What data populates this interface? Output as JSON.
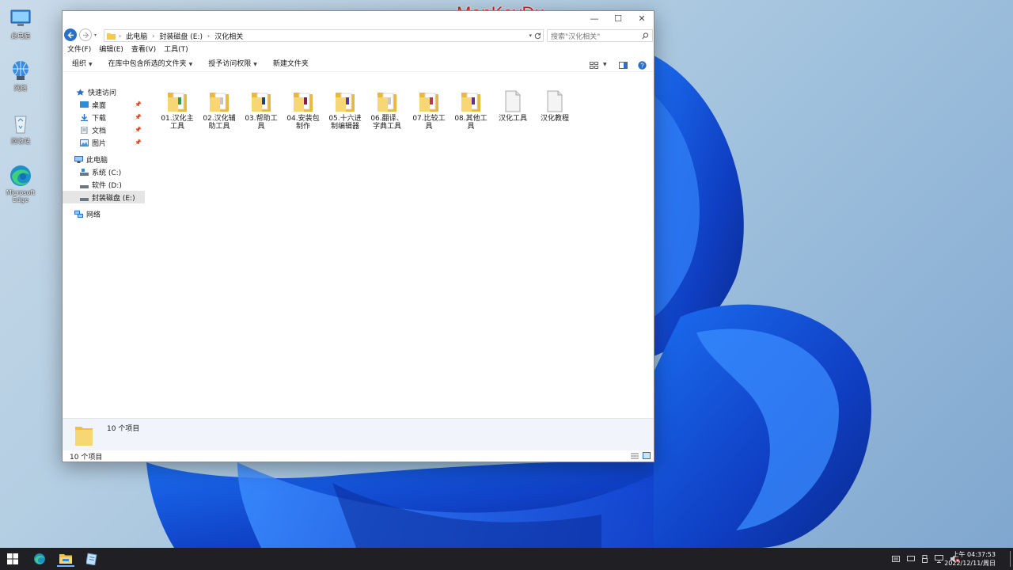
{
  "watermark": "MonKeyDu",
  "desktop": {
    "icons": [
      {
        "label": "此电脑",
        "icon": "computer-icon"
      },
      {
        "label": "网络",
        "icon": "network-icon"
      },
      {
        "label": "回收站",
        "icon": "recycle-bin-icon"
      },
      {
        "label": "Microsoft Edge",
        "icon": "edge-icon"
      }
    ]
  },
  "window": {
    "controls": {
      "minimize": "—",
      "maximize": "☐",
      "close": "✕"
    },
    "address": {
      "crumbs": [
        "此电脑",
        "封装磁盘 (E:)",
        "汉化相关"
      ]
    },
    "search": {
      "placeholder": "搜索\"汉化相关\""
    },
    "menu": [
      "文件(F)",
      "编辑(E)",
      "查看(V)",
      "工具(T)"
    ],
    "commands": [
      {
        "label": "组织",
        "dropdown": true
      },
      {
        "label": "在库中包含所选的文件夹",
        "dropdown": true
      },
      {
        "label": "授予访问权限",
        "dropdown": true
      },
      {
        "label": "新建文件夹",
        "dropdown": false
      }
    ],
    "nav": {
      "quick_access": "快速访问",
      "quick_items": [
        {
          "label": "桌面",
          "pinned": true
        },
        {
          "label": "下载",
          "pinned": true
        },
        {
          "label": "文档",
          "pinned": true
        },
        {
          "label": "图片",
          "pinned": true
        }
      ],
      "this_pc": "此电脑",
      "drives": [
        {
          "label": "系统 (C:)"
        },
        {
          "label": "软件 (D:)"
        },
        {
          "label": "封装磁盘 (E:)",
          "selected": true
        }
      ],
      "network": "网络"
    },
    "files": [
      {
        "line1": "01.汉化主",
        "line2": "工具",
        "type": "folder",
        "accent": "#2a9d4a"
      },
      {
        "line1": "02.汉化辅",
        "line2": "助工具",
        "type": "folder",
        "accent": "#c8c8c8"
      },
      {
        "line1": "03.帮助工",
        "line2": "具",
        "type": "folder",
        "accent": "#1f3f8a"
      },
      {
        "line1": "04.安装包",
        "line2": "制作",
        "type": "folder",
        "accent": "#8b1a4a"
      },
      {
        "line1": "05.十六进",
        "line2": "制编辑器",
        "type": "folder",
        "accent": "#5b3aa0"
      },
      {
        "line1": "06.翻译、",
        "line2": "字典工具",
        "type": "folder",
        "accent": "#c8c8c8"
      },
      {
        "line1": "07.比较工",
        "line2": "具",
        "type": "folder",
        "accent": "#b03a5a"
      },
      {
        "line1": "08.其他工",
        "line2": "具",
        "type": "folder",
        "accent": "#6a2a9a"
      },
      {
        "line1": "汉化工具",
        "line2": "",
        "type": "file",
        "accent": "#d0d0d0"
      },
      {
        "line1": "汉化教程",
        "line2": "",
        "type": "file",
        "accent": "#d0d0d0"
      }
    ],
    "details": {
      "count": "10 个项目"
    },
    "status": {
      "count": "10 个项目"
    }
  },
  "taskbar": {
    "apps": [
      "windows-start-icon",
      "edge-icon",
      "file-explorer-icon",
      "notepad-icon"
    ],
    "clock": {
      "time": "上午 04:37:53",
      "date": "2022/12/11/周日"
    }
  },
  "colors": {
    "accent": "#2a6fc9",
    "folder": "#f7d774",
    "taskbar": "#1f1f24"
  }
}
